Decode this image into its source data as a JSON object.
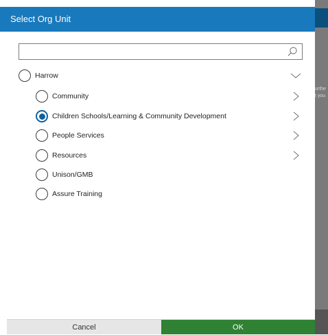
{
  "dialog": {
    "title": "Select Org Unit",
    "search": {
      "value": "",
      "placeholder": ""
    },
    "root": {
      "label": "Harrow",
      "selected": false,
      "expanded": true
    },
    "children": [
      {
        "label": "Community",
        "selected": false,
        "has_children": true
      },
      {
        "label": "Children Schools/Learning & Community Development",
        "selected": true,
        "has_children": true
      },
      {
        "label": "People Services",
        "selected": false,
        "has_children": true
      },
      {
        "label": "Resources",
        "selected": false,
        "has_children": true
      },
      {
        "label": "Unison/GMB",
        "selected": false,
        "has_children": false
      },
      {
        "label": "Assure Training",
        "selected": false,
        "has_children": false
      }
    ],
    "buttons": {
      "cancel": "Cancel",
      "ok": "OK"
    }
  },
  "backdrop": {
    "text_lines": [
      "urthe",
      "t you"
    ]
  },
  "colors": {
    "header": "#1979bd",
    "ok_button": "#2f8133",
    "cancel_button": "#e6e6e6",
    "radio_checked": "#0e5fa0"
  },
  "icons": {
    "search": "search-icon",
    "expand": "chevron-down-icon",
    "drill": "chevron-right-icon"
  }
}
